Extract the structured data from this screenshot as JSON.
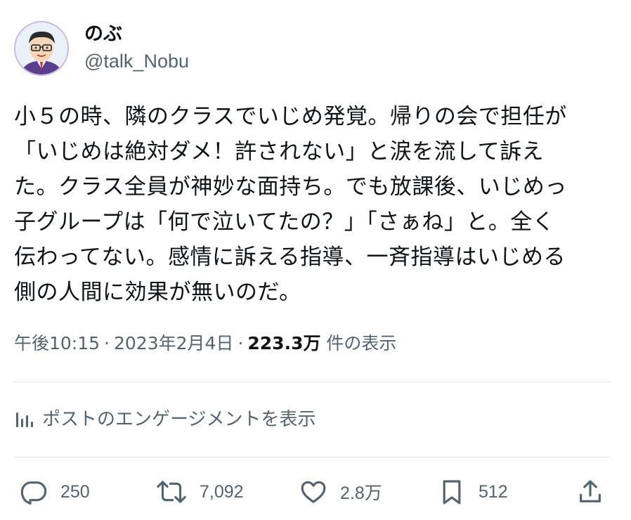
{
  "user": {
    "display_name": "のぶ",
    "handle": "@talk_Nobu"
  },
  "tweet": {
    "text": "小５の時、隣のクラスでいじめ発覚。帰りの会で担任が\n「いじめは絶対ダメ！許されない」と涙を流して訴え\nた。クラス全員が神妙な面持ち。でも放課後、いじめっ\n子グループは「何で泣いてたの？」「さぁね」と。全く\n伝わってない。感情に訴える指導、一斉指導はいじめる\n側の人間に効果が無いのだ。",
    "time": "午後10:15",
    "separator": "·",
    "date": "2023年2月4日",
    "views_count": "223.3万",
    "views_label": "件の表示"
  },
  "engagement": {
    "label": "ポストのエンゲージメントを表示",
    "icon": "analytics-icon"
  },
  "actions": {
    "replies": "250",
    "reposts": "7,092",
    "likes": "2.8万",
    "bookmarks": "512"
  },
  "colors": {
    "text": "#0f1419",
    "secondary": "#536471",
    "divider": "#e1e6ea"
  }
}
